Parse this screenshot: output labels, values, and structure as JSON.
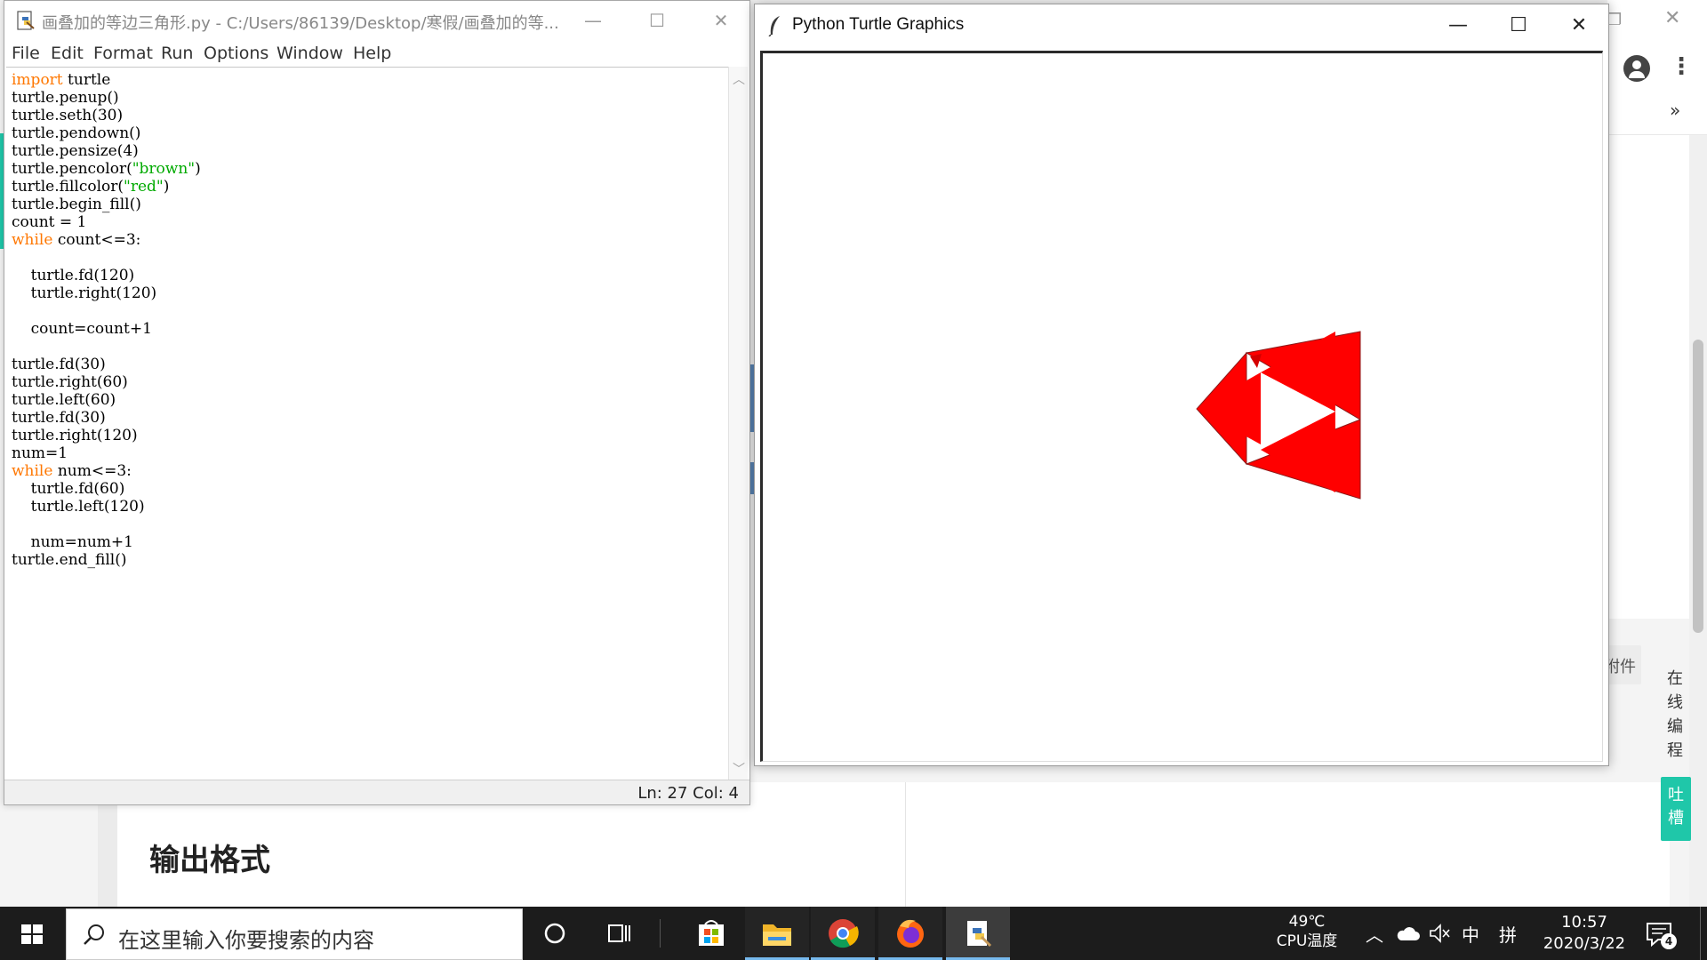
{
  "idle": {
    "title": "画叠加的等边三角形.py - C:/Users/86139/Desktop/寒假/画叠加的等...",
    "menu": [
      "File",
      "Edit",
      "Format",
      "Run",
      "Options",
      "Window",
      "Help"
    ],
    "status": "Ln: 27   Col: 4",
    "code": [
      [
        {
          "t": "import",
          "c": "kw"
        },
        {
          "t": " turtle"
        }
      ],
      [
        {
          "t": "turtle.penup()"
        }
      ],
      [
        {
          "t": "turtle.seth(30)"
        }
      ],
      [
        {
          "t": "turtle.pendown()"
        }
      ],
      [
        {
          "t": "turtle.pensize(4)"
        }
      ],
      [
        {
          "t": "turtle.pencolor("
        },
        {
          "t": "\"brown\"",
          "c": "str"
        },
        {
          "t": ")"
        }
      ],
      [
        {
          "t": "turtle.fillcolor("
        },
        {
          "t": "\"red\"",
          "c": "str"
        },
        {
          "t": ")"
        }
      ],
      [
        {
          "t": "turtle.begin_fill()"
        }
      ],
      [
        {
          "t": "count = 1"
        }
      ],
      [
        {
          "t": "while",
          "c": "kw"
        },
        {
          "t": " count<=3:"
        }
      ],
      [
        {
          "t": ""
        }
      ],
      [
        {
          "t": "    turtle.fd(120)"
        }
      ],
      [
        {
          "t": "    turtle.right(120)"
        }
      ],
      [
        {
          "t": ""
        }
      ],
      [
        {
          "t": "    count=count+1"
        }
      ],
      [
        {
          "t": ""
        }
      ],
      [
        {
          "t": "turtle.fd(30)"
        }
      ],
      [
        {
          "t": "turtle.right(60)"
        }
      ],
      [
        {
          "t": "turtle.left(60)"
        }
      ],
      [
        {
          "t": "turtle.fd(30)"
        }
      ],
      [
        {
          "t": "turtle.right(120)"
        }
      ],
      [
        {
          "t": "num=1"
        }
      ],
      [
        {
          "t": "while",
          "c": "kw"
        },
        {
          "t": " num<=3:"
        }
      ],
      [
        {
          "t": "    turtle.fd(60)"
        }
      ],
      [
        {
          "t": "    turtle.left(120)"
        }
      ],
      [
        {
          "t": ""
        }
      ],
      [
        {
          "t": "    num=num+1"
        }
      ],
      [
        {
          "t": "turtle.end_fill()"
        }
      ]
    ],
    "colors": {
      "keyword": "#ff7700",
      "string": "#00aa00"
    }
  },
  "turtle": {
    "title": "Python Turtle Graphics",
    "fill_color": "#ff0000",
    "pen_color": "brown"
  },
  "background": {
    "heading": "输出格式",
    "attach_label": "附件",
    "online_editor_label": [
      "在",
      "线",
      "编",
      "程"
    ],
    "feedback_label": [
      "吐",
      "槽"
    ]
  },
  "taskbar": {
    "search_placeholder": "在这里输入你要搜索的内容",
    "temperature": "49℃",
    "temperature_label": "CPU温度",
    "ime_lang": "中",
    "ime_mode": "拼",
    "time": "10:57",
    "date": "2020/3/22",
    "notification_count": "4"
  }
}
